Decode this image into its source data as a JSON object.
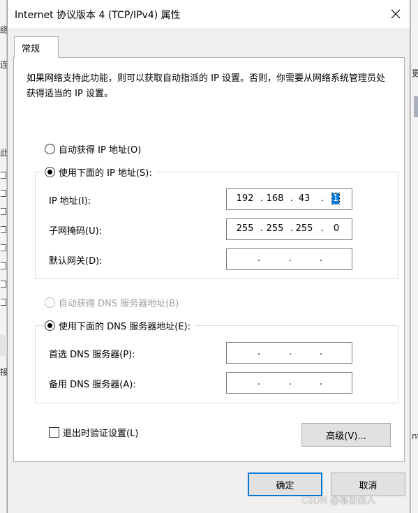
{
  "window": {
    "title": "Internet 协议版本 4 (TCP/IPv4) 属性",
    "close_icon": "close-icon"
  },
  "background": {
    "left_chars": [
      "络",
      "连",
      "此"
    ],
    "left_bottom_chars": [
      "接"
    ],
    "right_chars": [
      "更",
      "nt"
    ]
  },
  "tabs": [
    {
      "label": "常规",
      "selected": true
    }
  ],
  "general": {
    "description": "如果网络支持此功能，则可以获取自动指派的 IP 设置。否则，你需要从网络系统管理员处获得适当的 IP 设置。",
    "ip": {
      "auto_label": "自动获得 IP 地址(O)",
      "auto_checked": false,
      "manual_label": "使用下面的 IP 地址(S):",
      "manual_checked": true,
      "address": {
        "label": "IP 地址(I):",
        "octets": [
          "192",
          "168",
          "43",
          "1"
        ],
        "selected_octet": "1"
      },
      "subnet": {
        "label": "子网掩码(U):",
        "octets": [
          "255",
          "255",
          "255",
          "0"
        ]
      },
      "gateway": {
        "label": "默认网关(D):",
        "octets": [
          "",
          "",
          "",
          ""
        ]
      }
    },
    "dns": {
      "auto_label": "自动获得 DNS 服务器地址(B)",
      "auto_checked": false,
      "auto_disabled": true,
      "manual_label": "使用下面的 DNS 服务器地址(E):",
      "manual_checked": true,
      "preferred": {
        "label": "首选 DNS 服务器(P):",
        "octets": [
          "",
          "",
          "",
          ""
        ]
      },
      "alternate": {
        "label": "备用 DNS 服务器(A):",
        "octets": [
          "",
          "",
          "",
          ""
        ]
      }
    },
    "validate_label": "退出时验证设置(L)",
    "validate_checked": false,
    "advanced_label": "高级(V)..."
  },
  "footer": {
    "ok_label": "确定",
    "cancel_label": "取消"
  },
  "watermark": "CSDN @幕自由人",
  "colors": {
    "accent": "#0078d7",
    "disabled_text": "#a0a0a0",
    "dialog_bg": "#f0f0f0",
    "panel_bg": "#ffffff"
  }
}
